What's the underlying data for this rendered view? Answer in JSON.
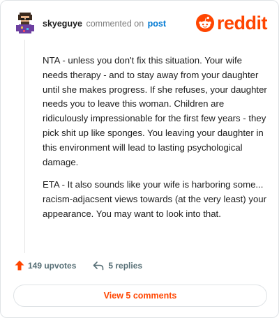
{
  "header": {
    "username": "skyeguye",
    "verb": "commented on",
    "post_link": "post"
  },
  "logo": {
    "wordmark": "reddit",
    "color": "#ff4500"
  },
  "comment": {
    "paragraphs": [
      "NTA - unless you don't fix this situation. Your wife needs therapy - and to stay away from your daughter until she makes progress. If she refuses, your daughter needs you to leave this woman. Children are ridiculously impressionable for the first few years - they pick shit up like sponges. You leaving your daughter in this environment will lead to lasting psychological damage.",
      "ETA - It also sounds like your wife is harboring some... racism-adjacsent views towards (at the very least) your appearance. You may want to look into that."
    ]
  },
  "actions": {
    "upvotes": "149 upvotes",
    "replies": "5 replies"
  },
  "footer": {
    "view_comments": "View 5 comments"
  },
  "icons": {
    "avatar": "pixel-avatar-icon",
    "logo": "reddit-snoo-icon",
    "upvote": "upvote-arrow-icon",
    "reply": "reply-arrow-icon"
  },
  "colors": {
    "accent": "#ff4500",
    "link": "#0079d3",
    "muted": "#576f76",
    "text": "#1c1c1c"
  }
}
